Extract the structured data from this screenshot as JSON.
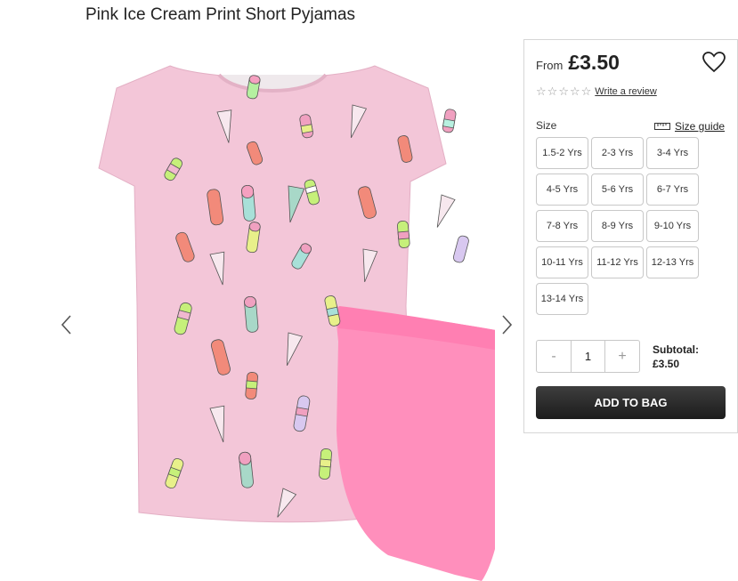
{
  "product": {
    "title": "Pink Ice Cream Print Short Pyjamas"
  },
  "gallery": {
    "prev_icon": "chevron-left-icon",
    "next_icon": "chevron-right-icon",
    "colors": {
      "top": "#f3c6d8",
      "shorts": "#ff8fbc"
    }
  },
  "panel": {
    "from_label": "From",
    "price": "£3.50",
    "wishlist_icon": "heart-icon",
    "rating_stars": 5,
    "review_link": "Write a review",
    "size_label": "Size",
    "size_guide_label": "Size guide",
    "sizes": [
      "1.5-2 Yrs",
      "2-3 Yrs",
      "3-4 Yrs",
      "4-5 Yrs",
      "5-6 Yrs",
      "6-7 Yrs",
      "7-8 Yrs",
      "8-9 Yrs",
      "9-10 Yrs",
      "10-11 Yrs",
      "11-12 Yrs",
      "12-13 Yrs",
      "13-14 Yrs"
    ],
    "qty_minus": "-",
    "qty_value": "1",
    "qty_plus": "+",
    "subtotal_label": "Subtotal:",
    "subtotal_value": "£3.50",
    "add_to_bag": "ADD TO BAG",
    "button_color": "#2a2a2a"
  }
}
